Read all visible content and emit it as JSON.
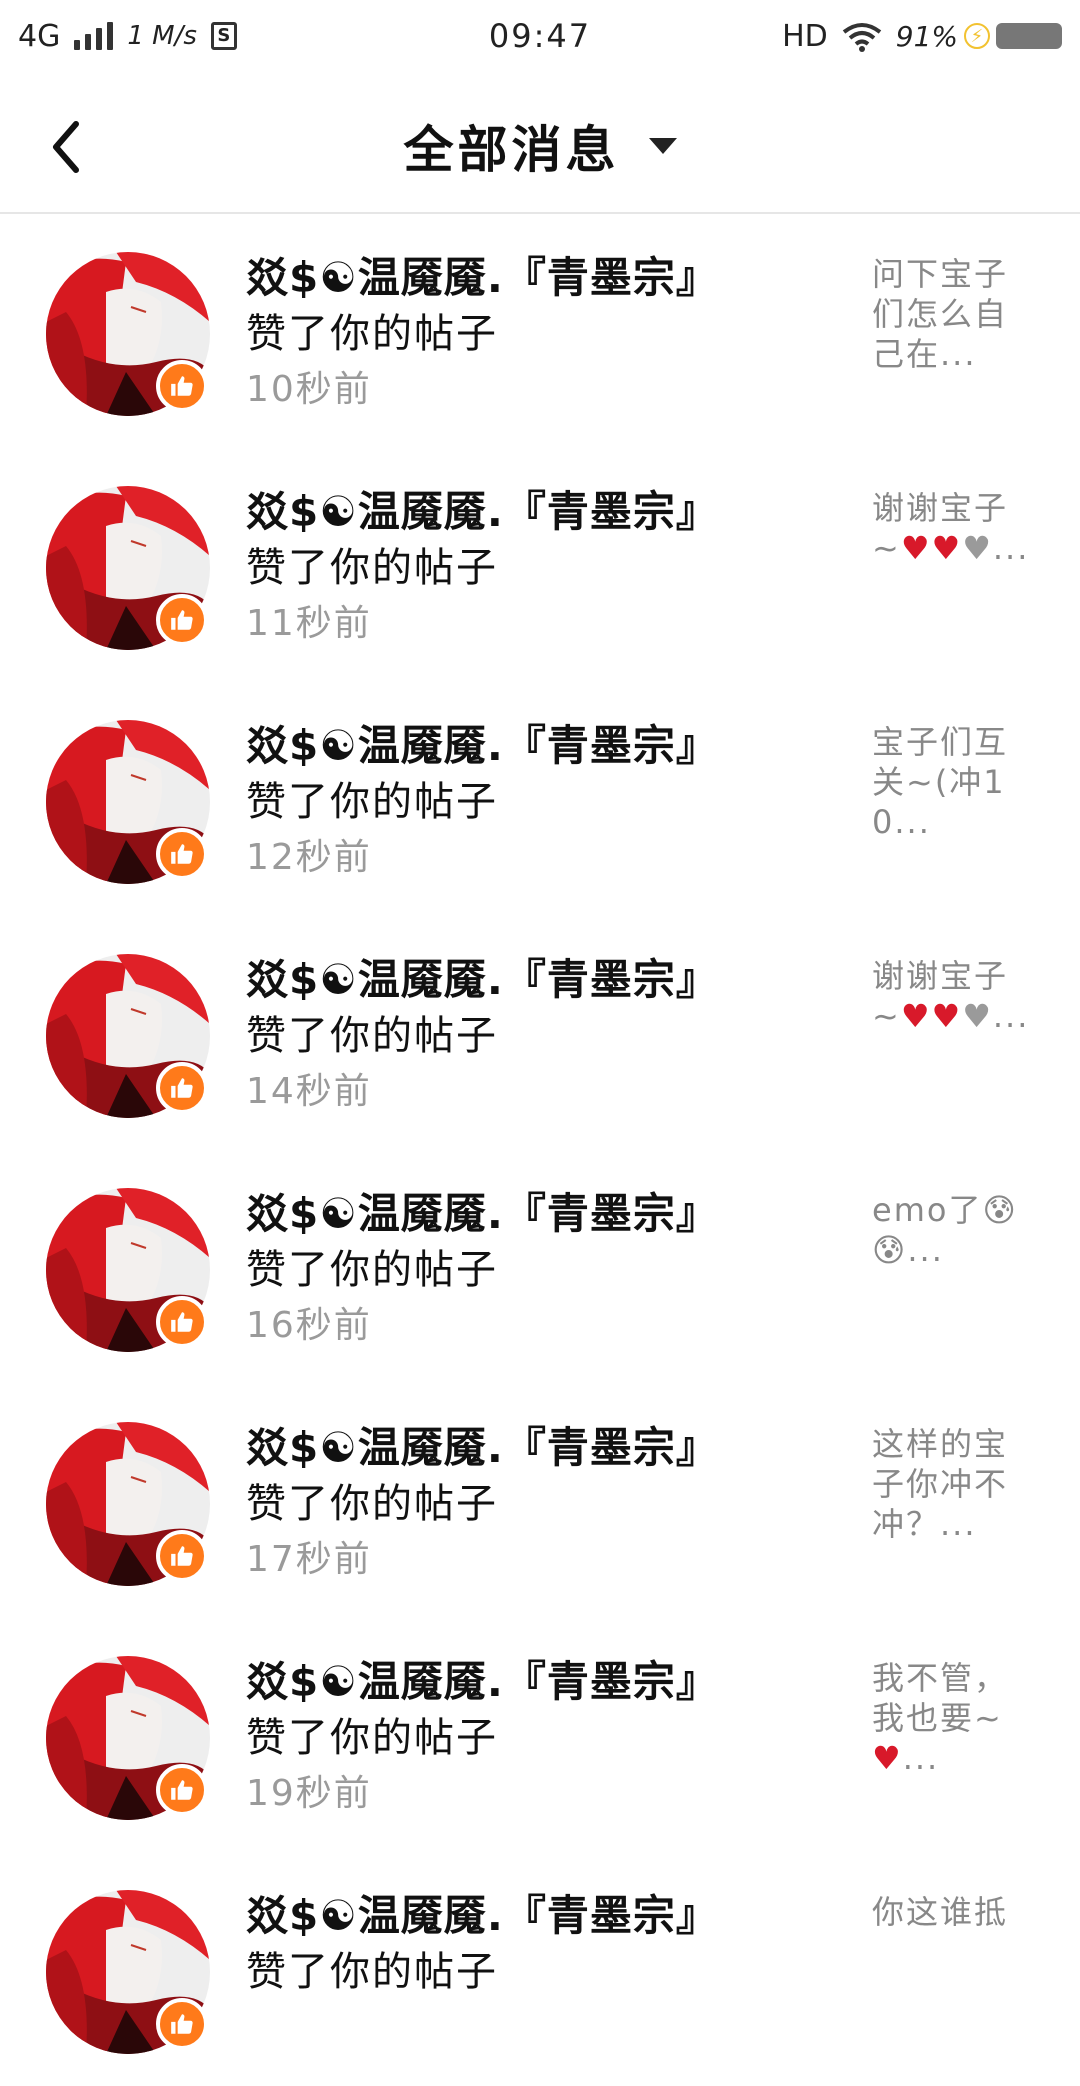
{
  "status_bar": {
    "network": "4G",
    "speed": "1 M/s",
    "sim": "S",
    "time": "09:47",
    "hd": "HD",
    "battery": "91%"
  },
  "header": {
    "title": "全部消息"
  },
  "items": [
    {
      "name": "㸚$☯温魇魇.『青墨宗』",
      "action": "赞了你的帖子",
      "time": "10秒前",
      "preview": "问下宝子们怎么自己在..."
    },
    {
      "name": "㸚$☯温魇魇.『青墨宗』",
      "action": "赞了你的帖子",
      "time": "11秒前",
      "preview_text": "谢谢宝子~",
      "preview_hearts": "♥♥",
      "preview_gray": "♥",
      "preview_tail": "..."
    },
    {
      "name": "㸚$☯温魇魇.『青墨宗』",
      "action": "赞了你的帖子",
      "time": "12秒前",
      "preview": "宝子们互关~(冲10..."
    },
    {
      "name": "㸚$☯温魇魇.『青墨宗』",
      "action": "赞了你的帖子",
      "time": "14秒前",
      "preview_text": "谢谢宝子~",
      "preview_hearts": "♥♥",
      "preview_gray": "♥",
      "preview_tail": "..."
    },
    {
      "name": "㸚$☯温魇魇.『青墨宗』",
      "action": "赞了你的帖子",
      "time": "16秒前",
      "preview": "emo了😰😰..."
    },
    {
      "name": "㸚$☯温魇魇.『青墨宗』",
      "action": "赞了你的帖子",
      "time": "17秒前",
      "preview": "这样的宝子你冲不冲？..."
    },
    {
      "name": "㸚$☯温魇魇.『青墨宗』",
      "action": "赞了你的帖子",
      "time": "19秒前",
      "preview_text": "我不管，我也要~",
      "preview_hearts": "♥",
      "preview_gray": "",
      "preview_tail": "..."
    },
    {
      "name": "㸚$☯温魇魇.『青墨宗』",
      "action": "赞了你的帖子",
      "time": "",
      "preview": "你这谁抵"
    }
  ],
  "colors": {
    "badge": "#ff7a1a",
    "time_text": "#9a9a9a",
    "preview_text": "#888888",
    "avatar_red": "#d71920"
  }
}
